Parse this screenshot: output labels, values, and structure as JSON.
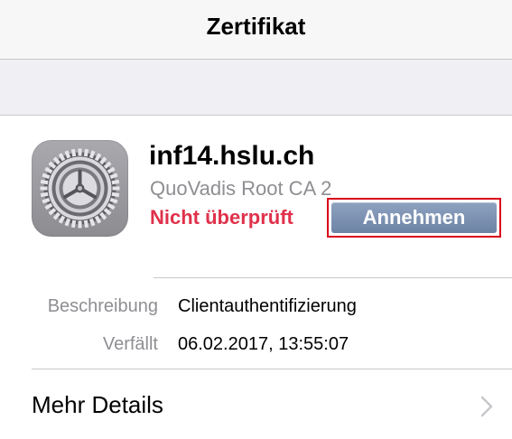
{
  "navbar": {
    "title": "Zertifikat"
  },
  "certificate": {
    "icon": "settings-gear-icon",
    "name": "inf14.hslu.ch",
    "issuer": "QuoVadis Root CA 2",
    "status": "Nicht überprüft",
    "status_color": "#e0314b",
    "accept_label": "Annehmen"
  },
  "details": {
    "rows": [
      {
        "label": "Beschreibung",
        "value": "Clientauthentifizierung"
      },
      {
        "label": "Verfällt",
        "value": "06.02.2017, 13:55:07"
      }
    ],
    "more_label": "Mehr Details",
    "more_icon": "chevron-right-icon"
  }
}
